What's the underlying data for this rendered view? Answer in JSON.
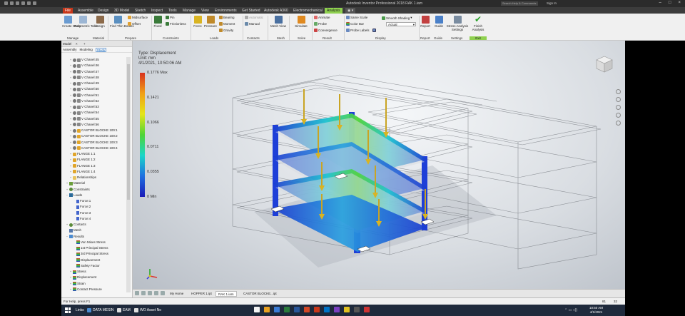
{
  "app": {
    "title": "Autodesk Inventor Professional 2018    RAK 1.iam",
    "search_placeholder": "Search Help & Commands...",
    "signin": "Sign In"
  },
  "ribbon_tabs": [
    "File",
    "Assemble",
    "Design",
    "3D Model",
    "Sketch",
    "Inspect",
    "Tools",
    "Manage",
    "View",
    "Environments",
    "Get Started",
    "Autodesk A360",
    "Electromechanical",
    "Analysis"
  ],
  "ribbon_tab_active": "Analysis",
  "ribbon": {
    "create_study": "Create Study",
    "parametric_table": "Parametric Table",
    "assign": "Assign",
    "find_thin_bodies": "Find Thin Bodies",
    "midsurface": "Midsurface",
    "offset": "Offset",
    "fixed": "Fixed",
    "pin": "Pin",
    "frictionless": "Frictionless",
    "force": "Force",
    "pressure": "Pressure",
    "bearing": "Bearing",
    "moment": "Moment",
    "gravity": "Gravity",
    "automatic": "Automatic",
    "manual": "Manual",
    "mesh_view": "Mesh View",
    "simulate": "Simulate",
    "animate": "Animate",
    "probe": "Probe",
    "convergence": "Convergence",
    "same_scale": "Same Scale",
    "color_bar": "Color Bar",
    "probe_labels": "Probe Labels",
    "smooth_shading": "Smooth Shading",
    "actual": "Actual",
    "report": "Report",
    "guide": "Guide",
    "stress_analysis_settings": "Stress Analysis Settings",
    "finish_analysis": "Finish Analysis",
    "groups": {
      "manage": "Manage",
      "material": "Material",
      "prepare": "Prepare",
      "constraints": "Constraints",
      "loads": "Loads",
      "contacts": "Contacts",
      "mesh": "Mesh",
      "solve": "Solve",
      "result": "Result",
      "display": "Display",
      "report": "Report",
      "guide": "Guide",
      "settings": "Settings",
      "exit": "Exit"
    }
  },
  "browser": {
    "header": "Model",
    "subtabs": [
      "Assembly",
      "Modeling",
      "Study"
    ],
    "active_subtab": "Study",
    "channels": [
      "V Chanel:45",
      "V Chanel:46",
      "V Chanel:47",
      "V Chanel:48",
      "V Chanel:49",
      "V Chanel:50",
      "V Chanel:51",
      "V Chanel:52",
      "V Chanel:53",
      "V Chanel:54",
      "V Chanel:55",
      "V Chanel:56"
    ],
    "castors": [
      "CASTOR BLOCKE 100:1",
      "CASTOR BLOCKE 100:2",
      "CASTOR BLOCKE 100:3",
      "CASTOR BLOCKE 100:4"
    ],
    "flanges": [
      "FLANGE 1:1",
      "FLANGE 1:2",
      "FLANGE 1:3",
      "FLANGE 1:4"
    ],
    "relationships": "Relationships",
    "material": "Material",
    "constraints": "Constraints",
    "loads": "Loads",
    "forces": [
      "Force:1",
      "Force:2",
      "Force:3",
      "Force:4"
    ],
    "contacts": "Contacts",
    "mesh": "Mesh",
    "results": "Results",
    "result_items": [
      "Von Mises Stress",
      "1st Principal Stress",
      "3rd Principal Stress",
      "Displacement",
      "Safety Factor",
      "Stress",
      "Displacement",
      "Strain",
      "Contact Pressure"
    ]
  },
  "viewport": {
    "type_line": "Type: Displacement",
    "unit_line": "Unit: mm",
    "date_line": "4/1/2021, 10:50:06 AM",
    "legend_labels": [
      "0.1776 Max",
      "0.1421",
      "0.1066",
      "0.0711",
      "0.0355",
      "0 Min"
    ],
    "legend_colors": [
      "#d8321e",
      "#f1a017",
      "#e5e519",
      "#4fd436",
      "#1ad6c9",
      "#1e6fe0",
      "#1a1ab8"
    ]
  },
  "doc_tabs": [
    "My Home",
    "HOPPER 1.ipt",
    "RAK 1.iam",
    "CASTOR BLOCKE...ipt"
  ],
  "doc_tab_active": "RAK 1.iam",
  "status": {
    "help": "For Help, press F1",
    "n1": "81",
    "n2": "32"
  },
  "taskbar": {
    "links": "Links",
    "items": [
      "DATA MESIN",
      "EAM",
      "WO Asset No"
    ],
    "time": "10:50 AM",
    "date": "4/1/2021"
  }
}
